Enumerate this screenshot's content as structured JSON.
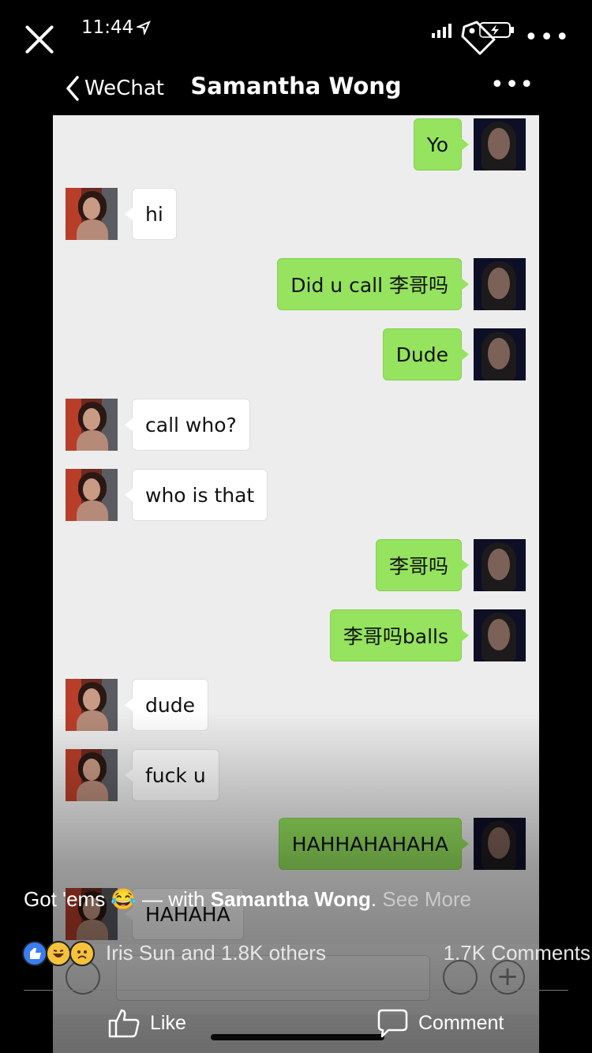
{
  "status_bar": {
    "time": "11:44"
  },
  "nav": {
    "back_label": "WeChat",
    "title": "Samantha Wong",
    "more": "•••"
  },
  "fb_top": {
    "more": "•••"
  },
  "messages": [
    {
      "from": "me",
      "text": "Yo"
    },
    {
      "from": "them",
      "text": "hi"
    },
    {
      "from": "me",
      "text": "Did u call 李哥吗"
    },
    {
      "from": "me",
      "text": "Dude"
    },
    {
      "from": "them",
      "text": "call who?"
    },
    {
      "from": "them",
      "text": "who is that"
    },
    {
      "from": "me",
      "text": "李哥吗"
    },
    {
      "from": "me",
      "text": "李哥吗balls"
    },
    {
      "from": "them",
      "text": "dude"
    },
    {
      "from": "them",
      "text": "fuck u"
    },
    {
      "from": "me",
      "text": "HAHHAHAHAHA"
    },
    {
      "from": "them",
      "text": "HAHAHA"
    }
  ],
  "caption": {
    "prefix": "Got 'ems 😂 — with ",
    "tagged": "Samantha Wong",
    "suffix": ". ",
    "see_more": "See More"
  },
  "reactions": {
    "text": "Iris Sun and 1.8K others",
    "comments": "1.7K Comments"
  },
  "actions": {
    "like": "Like",
    "comment": "Comment"
  },
  "colors": {
    "sent_bubble": "#95e35e",
    "received_bubble": "#ffffff",
    "chat_bg": "#ededed"
  }
}
